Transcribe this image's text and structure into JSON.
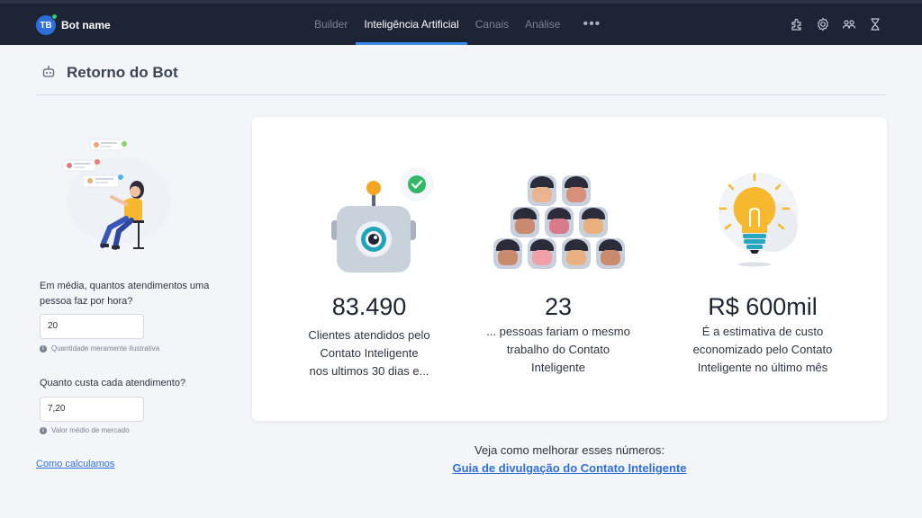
{
  "topbar": {
    "avatar_initials": "TB",
    "bot_name": "Bot name",
    "tabs": [
      {
        "label": "Builder"
      },
      {
        "label": "Inteligência Artificial"
      },
      {
        "label": "Canais"
      },
      {
        "label": "Análise"
      }
    ],
    "more": "•••",
    "icons": [
      "puzzle-icon",
      "gear-icon",
      "team-icon",
      "hourglass-icon"
    ]
  },
  "header": {
    "title": "Retorno do Bot",
    "icon": "robot-icon"
  },
  "left": {
    "q1_label": "Em média, quantos atendimentos uma pessoa faz por hora?",
    "q1_value": "20",
    "q1_hint": "Quantidade meramente ilustrativa",
    "q2_label": "Quanto custa cada atendimento?",
    "q2_value": "7,20",
    "q2_hint": "Valor médio de mercado",
    "how_link": "Como calculamos"
  },
  "stats": [
    {
      "value": "83.490",
      "line1": "Clientes atendidos pelo",
      "line2": "Contato Inteligente",
      "line3": "nos ultimos 30 dias e..."
    },
    {
      "value": "23",
      "line1": "... pessoas fariam o mesmo",
      "line2": "trabalho do Contato",
      "line3": "Inteligente"
    },
    {
      "value": "R$ 600mil",
      "line1": "É a estimativa de custo",
      "line2": "economizado pelo Contato",
      "line3": "Inteligente no último mês"
    }
  ],
  "footer": {
    "text": "Veja como melhorar esses números:",
    "link": "Guia de divulgação do Contato Inteligente"
  },
  "colors": {
    "accent": "#3d8ef0",
    "topbar": "#1d2435",
    "link": "#2f6fd9"
  }
}
